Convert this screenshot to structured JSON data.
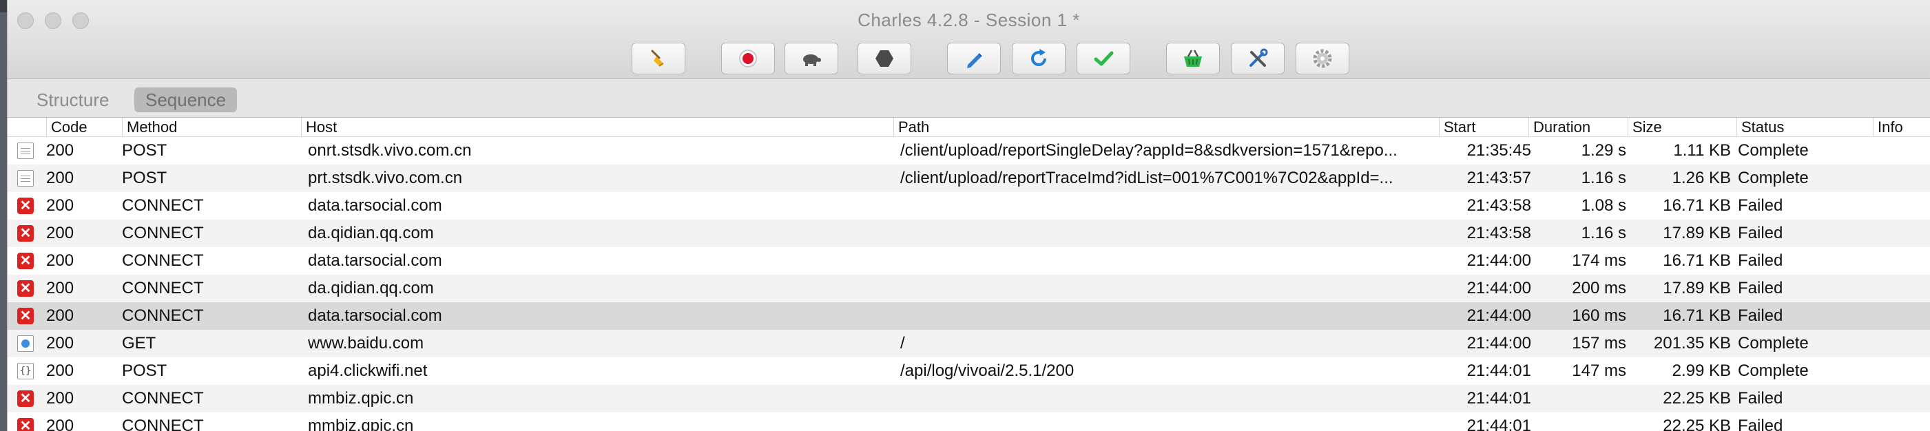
{
  "window": {
    "title": "Charles 4.2.8 - Session 1 *"
  },
  "toolbar": {
    "buttons": [
      {
        "name": "broom-icon",
        "glyph": "🧹"
      },
      {
        "name": "record-icon",
        "glyph": ""
      },
      {
        "name": "throttle-turtle-icon",
        "glyph": ""
      },
      {
        "name": "breakpoint-stop-icon",
        "glyph": ""
      },
      {
        "name": "compose-pen-icon",
        "glyph": ""
      },
      {
        "name": "repeat-icon",
        "glyph": ""
      },
      {
        "name": "validate-check-icon",
        "glyph": ""
      },
      {
        "name": "basket-icon",
        "glyph": ""
      },
      {
        "name": "tools-icon",
        "glyph": ""
      },
      {
        "name": "settings-gear-icon",
        "glyph": ""
      }
    ]
  },
  "view_tabs": {
    "structure": "Structure",
    "sequence": "Sequence"
  },
  "columns": {
    "code": "Code",
    "method": "Method",
    "host": "Host",
    "path": "Path",
    "start": "Start",
    "duration": "Duration",
    "size": "Size",
    "status": "Status",
    "info": "Info"
  },
  "rows": [
    {
      "icon": "doc",
      "code": "200",
      "method": "POST",
      "host": "onrt.stsdk.vivo.com.cn",
      "path": "/client/upload/reportSingleDelay?appId=8&sdkversion=1571&repo...",
      "start": "21:35:45",
      "duration": "1.29 s",
      "size": "1.11 KB",
      "status": "Complete",
      "info": ""
    },
    {
      "icon": "doc",
      "code": "200",
      "method": "POST",
      "host": "prt.stsdk.vivo.com.cn",
      "path": "/client/upload/reportTraceImd?idList=001%7C001%7C02&appId=...",
      "start": "21:43:57",
      "duration": "1.16 s",
      "size": "1.26 KB",
      "status": "Complete",
      "info": ""
    },
    {
      "icon": "failed",
      "code": "200",
      "method": "CONNECT",
      "host": "data.tarsocial.com",
      "path": "",
      "start": "21:43:58",
      "duration": "1.08 s",
      "size": "16.71 KB",
      "status": "Failed",
      "info": ""
    },
    {
      "icon": "failed",
      "code": "200",
      "method": "CONNECT",
      "host": "da.qidian.qq.com",
      "path": "",
      "start": "21:43:58",
      "duration": "1.16 s",
      "size": "17.89 KB",
      "status": "Failed",
      "info": ""
    },
    {
      "icon": "failed",
      "code": "200",
      "method": "CONNECT",
      "host": "data.tarsocial.com",
      "path": "",
      "start": "21:44:00",
      "duration": "174 ms",
      "size": "16.71 KB",
      "status": "Failed",
      "info": ""
    },
    {
      "icon": "failed",
      "code": "200",
      "method": "CONNECT",
      "host": "da.qidian.qq.com",
      "path": "",
      "start": "21:44:00",
      "duration": "200 ms",
      "size": "17.89 KB",
      "status": "Failed",
      "info": ""
    },
    {
      "icon": "failed",
      "code": "200",
      "method": "CONNECT",
      "host": "data.tarsocial.com",
      "path": "",
      "start": "21:44:00",
      "duration": "160 ms",
      "size": "16.71 KB",
      "status": "Failed",
      "info": "",
      "selected": true
    },
    {
      "icon": "web",
      "code": "200",
      "method": "GET",
      "host": "www.baidu.com",
      "path": "/",
      "start": "21:44:00",
      "duration": "157 ms",
      "size": "201.35 KB",
      "status": "Complete",
      "info": ""
    },
    {
      "icon": "json",
      "code": "200",
      "method": "POST",
      "host": "api4.clickwifi.net",
      "path": "/api/log/vivoai/2.5.1/200",
      "start": "21:44:01",
      "duration": "147 ms",
      "size": "2.99 KB",
      "status": "Complete",
      "info": ""
    },
    {
      "icon": "failed",
      "code": "200",
      "method": "CONNECT",
      "host": "mmbiz.qpic.cn",
      "path": "",
      "start": "21:44:01",
      "duration": "",
      "size": "22.25 KB",
      "status": "Failed",
      "info": ""
    },
    {
      "icon": "failed",
      "code": "200",
      "method": "CONNECT",
      "host": "mmbiz.qpic.cn",
      "path": "",
      "start": "21:44:01",
      "duration": "",
      "size": "22.25 KB",
      "status": "Failed",
      "info": ""
    }
  ]
}
